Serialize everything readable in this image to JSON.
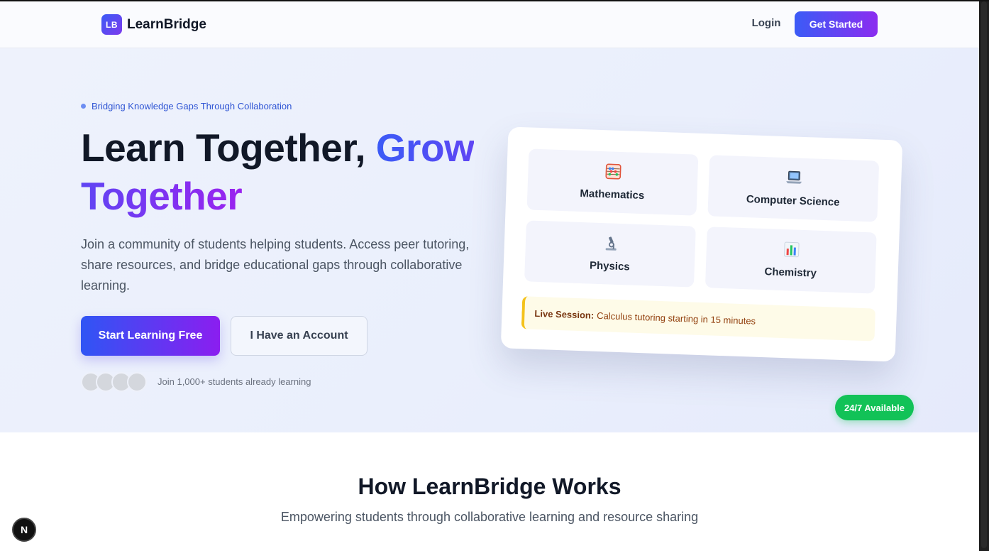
{
  "header": {
    "logo_badge": "LB",
    "logo_text": "LearnBridge",
    "login_label": "Login",
    "get_started_label": "Get Started"
  },
  "hero": {
    "tagline": "Bridging Knowledge Gaps Through Collaboration",
    "title_part1": "Learn Together, ",
    "title_part2": "Grow Together",
    "description": "Join a community of students helping students. Access peer tutoring, share resources, and bridge educational gaps through collaborative learning.",
    "primary_button": "Start Learning Free",
    "secondary_button": "I Have an Account",
    "social_proof": "Join 1,000+ students already learning"
  },
  "card": {
    "subjects": [
      {
        "label": "Mathematics",
        "icon": "abacus-icon"
      },
      {
        "label": "Computer Science",
        "icon": "laptop-icon"
      },
      {
        "label": "Physics",
        "icon": "microscope-icon"
      },
      {
        "label": "Chemistry",
        "icon": "bar-chart-icon"
      }
    ],
    "live_label": "Live Session:",
    "live_text": "Calculus tutoring starting in 15 minutes"
  },
  "availability_badge": "24/7 Available",
  "how": {
    "title": "How LearnBridge Works",
    "subtitle": "Empowering students through collaborative learning and resource sharing"
  },
  "dev_badge": "N",
  "colors": {
    "accent_blue": "#3b5bf6",
    "accent_purple": "#8b2df0",
    "success_green": "#12c257",
    "live_yellow": "#f4c21b"
  }
}
